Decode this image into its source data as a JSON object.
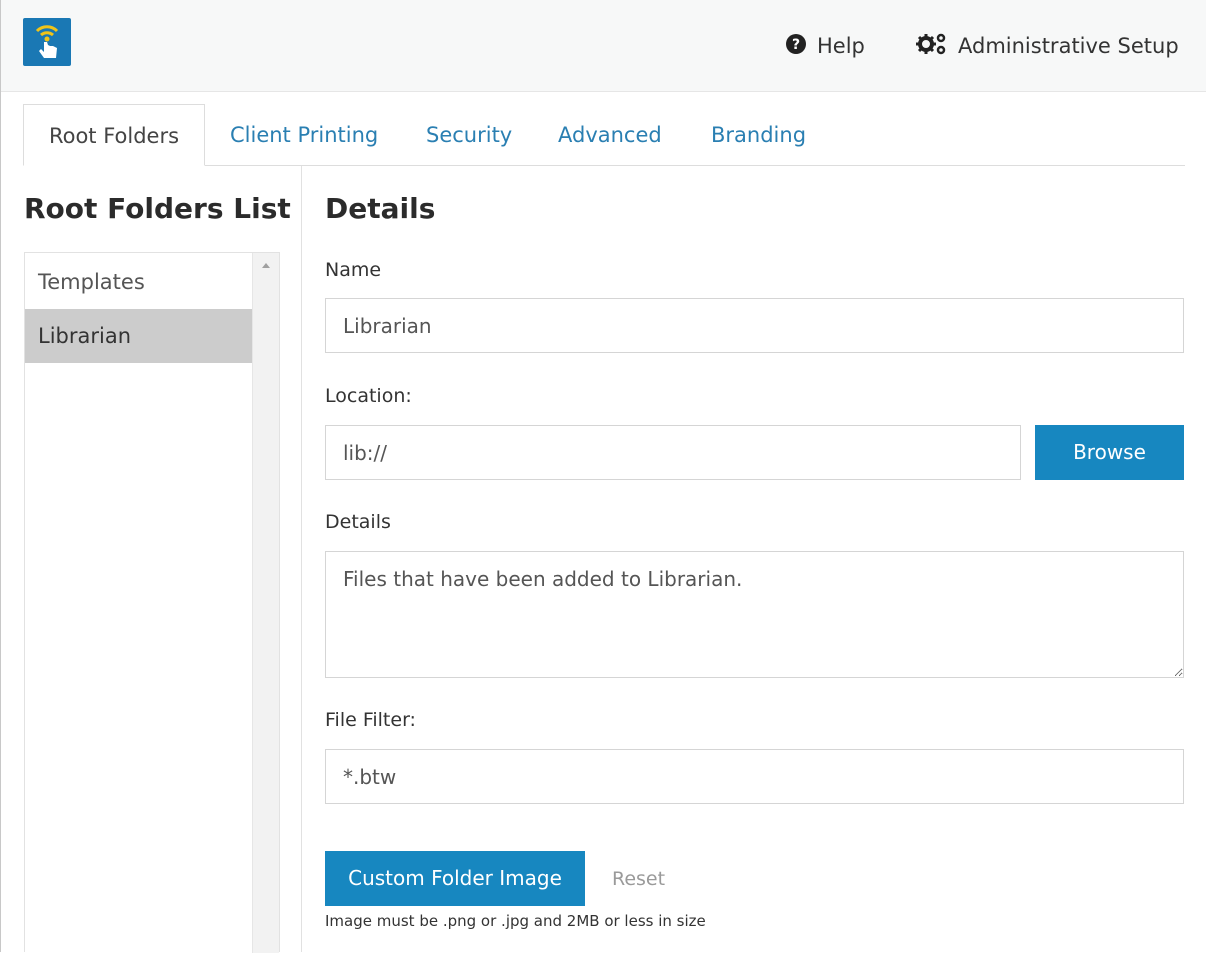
{
  "header": {
    "logo_icon": "touch-print-icon",
    "help_label": "Help",
    "admin_label": "Administrative Setup"
  },
  "tabs": [
    {
      "label": "Root Folders",
      "active": true
    },
    {
      "label": "Client Printing",
      "active": false
    },
    {
      "label": "Security",
      "active": false
    },
    {
      "label": "Advanced",
      "active": false
    },
    {
      "label": "Branding",
      "active": false
    }
  ],
  "sidebar": {
    "title": "Root Folders List",
    "items": [
      {
        "label": "Templates",
        "selected": false
      },
      {
        "label": "Librarian",
        "selected": true
      }
    ]
  },
  "details": {
    "title": "Details",
    "name_label": "Name",
    "name_value": "Librarian",
    "location_label": "Location:",
    "location_value": "lib://",
    "browse_label": "Browse",
    "details_label": "Details",
    "details_value": "Files that have been added to Librarian.",
    "filter_label": "File Filter:",
    "filter_value": "*.btw",
    "custom_image_label": "Custom Folder Image",
    "reset_label": "Reset",
    "hint": "Image must be .png or .jpg and 2MB or less in size"
  },
  "colors": {
    "accent": "#1787c0",
    "tab_link": "#2a7fb2",
    "selected_row": "#cccccc"
  }
}
